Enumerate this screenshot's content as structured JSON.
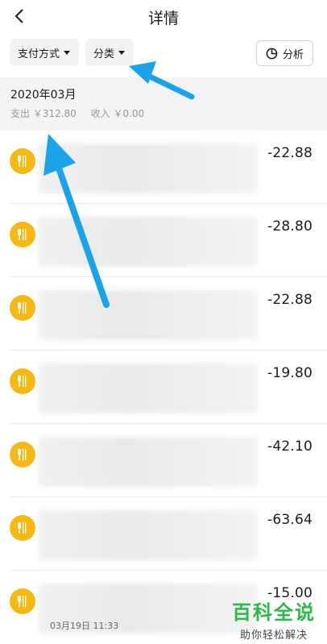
{
  "header": {
    "title": "详情",
    "back_icon": "chevron-left-icon"
  },
  "filters": {
    "payment_method": "支付方式",
    "category": "分类",
    "analysis": "分析",
    "analysis_icon": "pie-chart-icon"
  },
  "month": {
    "title": "2020年03月",
    "expense": "支出 ￥312.80",
    "income": "收入 ￥0.00"
  },
  "transactions": [
    {
      "amount": "-22.88",
      "icon": "dining-icon"
    },
    {
      "amount": "-28.80",
      "icon": "dining-icon"
    },
    {
      "amount": "-22.88",
      "icon": "dining-icon"
    },
    {
      "amount": "-19.80",
      "icon": "dining-icon"
    },
    {
      "amount": "-42.10",
      "icon": "dining-icon"
    },
    {
      "amount": "-63.64",
      "icon": "dining-icon"
    },
    {
      "amount": "-15.00",
      "icon": "dining-icon"
    }
  ],
  "last_row_date": "03月19日 11:33",
  "watermark": {
    "title": "百科全说",
    "subtitle": "助你轻松解决"
  },
  "colors": {
    "accent_icon": "#f6b913",
    "arrow": "#1aa3e8",
    "watermark": "#2fb84a"
  }
}
